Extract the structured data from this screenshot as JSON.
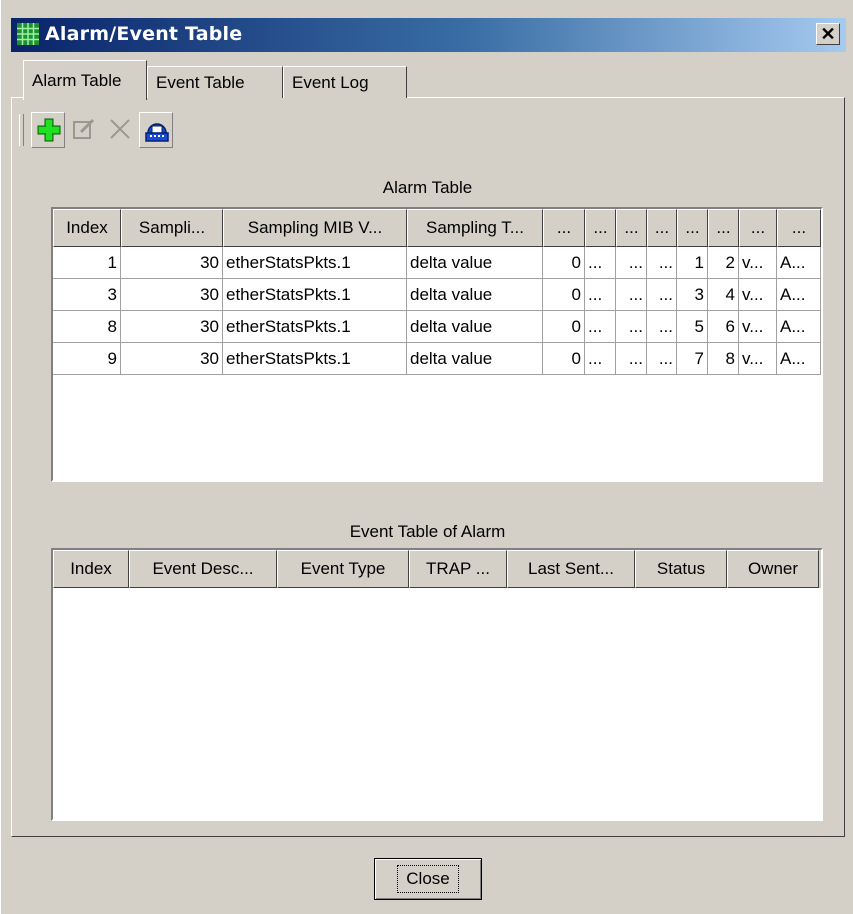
{
  "window": {
    "title": "Alarm/Event Table",
    "close_glyph": "✕"
  },
  "tabs": [
    {
      "label": "Alarm Table",
      "active": true
    },
    {
      "label": "Event Table",
      "active": false
    },
    {
      "label": "Event Log",
      "active": false
    }
  ],
  "toolbar": {
    "buttons": [
      {
        "icon": "add-icon",
        "enabled": true
      },
      {
        "icon": "edit-icon",
        "enabled": false
      },
      {
        "icon": "delete-icon",
        "enabled": false
      },
      {
        "icon": "refresh-icon",
        "enabled": true
      }
    ]
  },
  "alarm_table": {
    "label": "Alarm Table",
    "columns": [
      "Index",
      "Sampli...",
      "Sampling MIB V...",
      "Sampling T...",
      "...",
      "...",
      "...",
      "...",
      "...",
      "...",
      "...",
      "..."
    ],
    "rows": [
      [
        "1",
        "30",
        "etherStatsPkts.1",
        "delta value",
        "0",
        "...",
        "...",
        "...",
        "1",
        "2",
        "v...",
        "A..."
      ],
      [
        "3",
        "30",
        "etherStatsPkts.1",
        "delta value",
        "0",
        "...",
        "...",
        "...",
        "3",
        "4",
        "v...",
        "A..."
      ],
      [
        "8",
        "30",
        "etherStatsPkts.1",
        "delta value",
        "0",
        "...",
        "...",
        "...",
        "5",
        "6",
        "v...",
        "A..."
      ],
      [
        "9",
        "30",
        "etherStatsPkts.1",
        "delta value",
        "0",
        "...",
        "...",
        "...",
        "7",
        "8",
        "v...",
        "A..."
      ]
    ]
  },
  "event_table": {
    "label": "Event Table of Alarm",
    "columns": [
      "Index",
      "Event Desc...",
      "Event Type",
      "TRAP ...",
      "Last Sent...",
      "Status",
      "Owner"
    ],
    "rows": []
  },
  "footer": {
    "close_label": "Close"
  },
  "colors": {
    "title_bar_start": "#0a246a",
    "title_bar_end": "#a6caf0",
    "face": "#d4d0c8"
  }
}
